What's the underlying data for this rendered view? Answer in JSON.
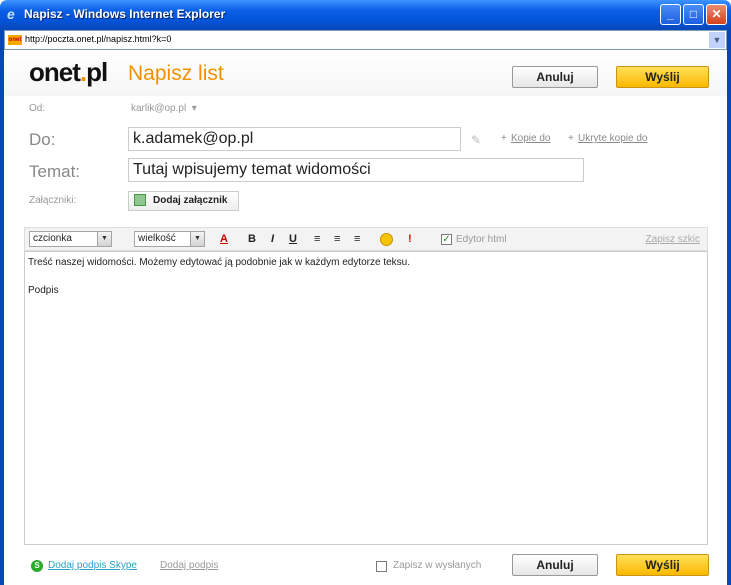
{
  "window": {
    "title": "Napisz - Windows Internet Explorer",
    "url": "http://poczta.onet.pl/napisz.html?k=0"
  },
  "header": {
    "logo_main": "onet",
    "logo_dot": ".",
    "logo_tld": "pl",
    "title": "Napisz list",
    "cancel": "Anuluj",
    "send": "Wyślij"
  },
  "form": {
    "from_label": "Od:",
    "from_value": "karlik@op.pl",
    "to_label": "Do:",
    "to_value": "k.adamek@op.pl",
    "cc_link": "Kopie do",
    "bcc_link": "Ukryte kopie do",
    "subject_label": "Temat:",
    "subject_value": "Tutaj wpisujemy temat widomości",
    "attachments_label": "Załączniki:",
    "add_attachment": "Dodaj załącznik"
  },
  "toolbar": {
    "font_select": "czcionka",
    "size_select": "wielkość",
    "color_glyph": "A",
    "bold_glyph": "B",
    "italic_glyph": "I",
    "underline_glyph": "U",
    "important_glyph": "!",
    "html_editor": "Edytor html",
    "save_draft": "Zapisz szkic"
  },
  "editor": {
    "body_line1": "Treść naszej widomości. Możemy edytować ją podobnie jak w każdym edytorze teksu.",
    "body_line2": "Podpis"
  },
  "footer": {
    "skype_signature": "Dodaj podpis Skype",
    "signature": "Dodaj podpis",
    "save_sent": "Zapisz w wysłanych",
    "cancel": "Anuluj",
    "send": "Wyślij"
  },
  "colors": {
    "accent": "#f29100",
    "send_button": "#f9b800",
    "titlebar": "#0353d8"
  }
}
